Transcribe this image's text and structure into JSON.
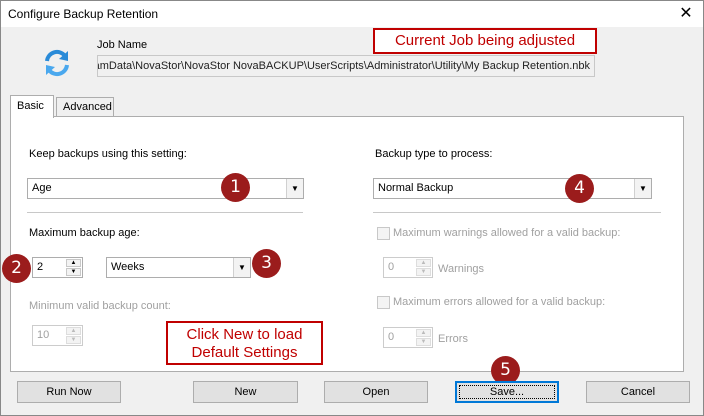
{
  "window": {
    "title": "Configure Backup Retention",
    "close_glyph": "✕"
  },
  "job": {
    "label": "Job Name",
    "path": "C:\\ProgramData\\NovaStor\\NovaStor NovaBACKUP\\UserScripts\\Administrator\\Utility\\My Backup Retention.nbk",
    "callout": "Current Job being adjusted"
  },
  "tabs": [
    {
      "label": "Basic",
      "active": true
    },
    {
      "label": "Advanced",
      "active": false
    }
  ],
  "basic": {
    "keep_label": "Keep backups using this setting:",
    "keep_value": "Age",
    "type_label": "Backup type to process:",
    "type_value": "Normal Backup",
    "max_age_label": "Maximum backup age:",
    "max_age_value": "2",
    "max_age_unit": "Weeks",
    "min_count_label": "Minimum valid backup count:",
    "min_count_value": "10",
    "max_warn_label": "Maximum warnings allowed for a valid backup:",
    "warn_value": "0",
    "warn_unit": "Warnings",
    "max_err_label": "Maximum errors allowed for a valid backup:",
    "err_value": "0",
    "err_unit": "Errors"
  },
  "callout_new": "Click New to load Default Settings",
  "badges": [
    "1",
    "2",
    "3",
    "4",
    "5"
  ],
  "buttons": {
    "run_now": "Run Now",
    "new": "New",
    "open": "Open",
    "save": "Save...",
    "cancel": "Cancel"
  },
  "icons": {
    "app": "refresh-arrows-icon",
    "dropdown": "chevron-down-icon",
    "spin_up": "spin-up-icon",
    "spin_down": "spin-down-icon"
  },
  "colors": {
    "accent_badge": "#9b1c1c",
    "callout_red": "#c00000",
    "app_icon_blue": "#2a8bd8"
  }
}
